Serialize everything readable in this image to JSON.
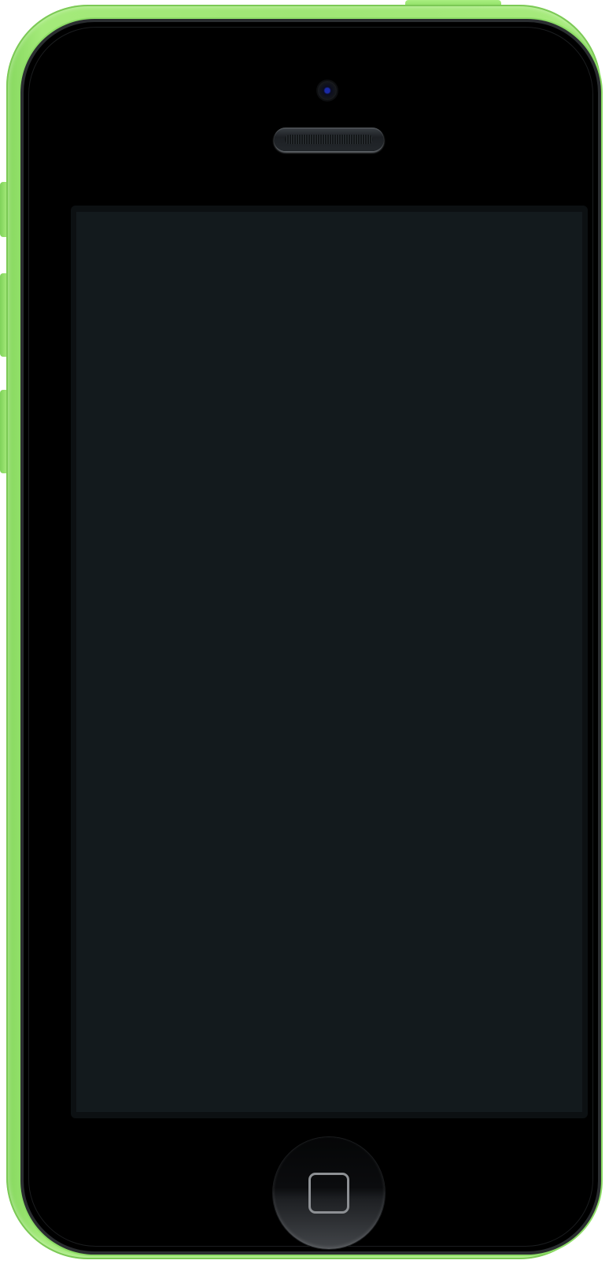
{
  "device": {
    "model": "iPhone 5c",
    "shell_color": "#a2e978",
    "screen_color": "#131a1d",
    "icons": {
      "camera": "front-camera-icon",
      "speaker": "earpiece-speaker-icon",
      "home": "home-button-square-icon"
    }
  }
}
